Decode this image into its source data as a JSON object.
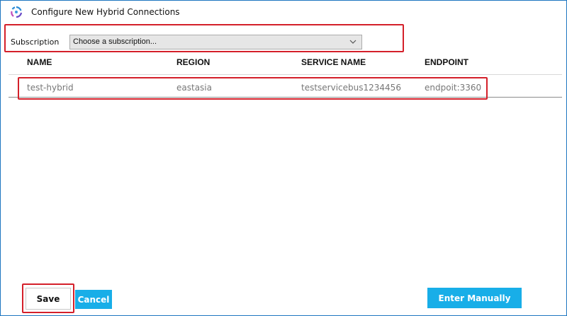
{
  "window": {
    "title": "Configure New Hybrid Connections",
    "icon": "hybrid-connection-icon"
  },
  "subscription": {
    "label": "Subscription",
    "selected": "Choose a subscription..."
  },
  "table": {
    "columns": [
      "NAME",
      "REGION",
      "SERVICE NAME",
      "ENDPOINT"
    ],
    "rows": [
      {
        "name": "test-hybrid",
        "region": "eastasia",
        "service_name": "testservicebus1234456",
        "endpoint": "endpoit:3360"
      }
    ]
  },
  "buttons": {
    "save": "Save",
    "cancel": "Cancel",
    "enter_manually": "Enter Manually"
  },
  "colors": {
    "accent": "#18aee8",
    "highlight": "#d4202a",
    "window_border": "#1e76c0"
  }
}
